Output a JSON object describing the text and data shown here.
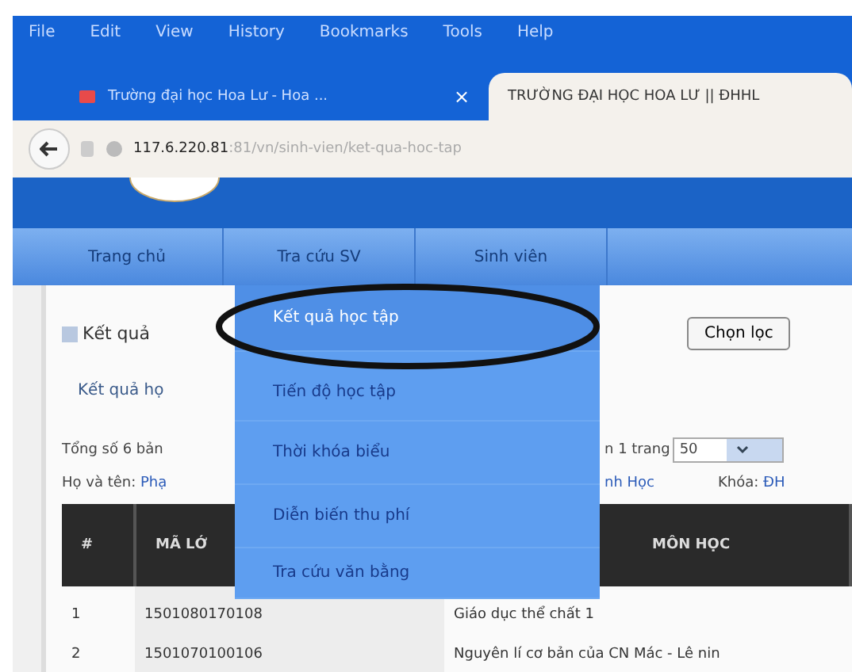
{
  "menu_bar": [
    "File",
    "Edit",
    "View",
    "History",
    "Bookmarks",
    "Tools",
    "Help"
  ],
  "tabs": [
    {
      "label": "Trường đại học Hoa Lư - Hoa ...",
      "selected": false,
      "close": "×"
    },
    {
      "label": "TRƯỜNG ĐẠI HỌC HOA LƯ || ĐHHL",
      "selected": true
    }
  ],
  "address": {
    "host": "117.6.220.81",
    "path": ":81/vn/sinh-vien/ket-qua-hoc-tap"
  },
  "nav": [
    "Trang chủ",
    "Tra cứu SV",
    "Sinh viên"
  ],
  "dropdown": [
    {
      "label": "Kết quả học tập",
      "selected": true
    },
    {
      "label": "Tiến độ học tập",
      "selected": false
    },
    {
      "label": "Thời khóa biểu",
      "selected": false
    },
    {
      "label": "Diễn biến thu phí",
      "selected": false
    },
    {
      "label": "Tra cứu văn bằng",
      "selected": false
    }
  ],
  "panel": {
    "title": "Kết quả",
    "button": "Chọn lọc",
    "subtab": "Kết quả họ"
  },
  "summary": {
    "left": "Tổng số 6 bản",
    "right": "n 1 trang",
    "page_size": "50"
  },
  "student": {
    "name_label": "Họ và tên:",
    "name_value": "Phạ",
    "middle_value": "nh Học",
    "course_label": "Khóa:",
    "course_value": "ĐH"
  },
  "table": {
    "columns": [
      "#",
      "MÃ LỚ",
      "MÔN HỌC"
    ],
    "rows": [
      [
        "1",
        "1501080170108",
        "Giáo dục thể chất 1"
      ],
      [
        "2",
        "1501070100106",
        "Nguyên lí cơ bản của CN Mác - Lê nin"
      ]
    ]
  }
}
